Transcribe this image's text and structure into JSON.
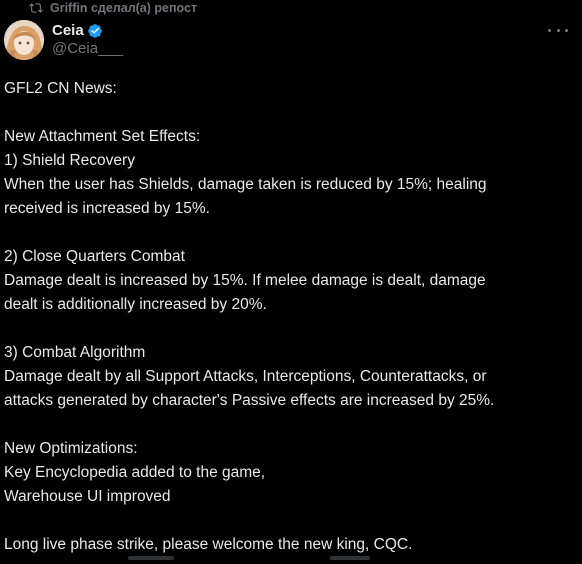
{
  "repost": {
    "icon": "repost-icon",
    "text": "Griffin сделал(а) репост"
  },
  "author": {
    "name": "Ceia",
    "handle": "@Ceia___",
    "verified_color": "#1d9bf0"
  },
  "tweet": {
    "lines": [
      "GFL2 CN News:",
      "",
      "New Attachment Set Effects:",
      "1) Shield Recovery",
      "When the user has Shields, damage taken is reduced by 15%; healing",
      "received is increased by 15%.",
      "",
      "2) Close Quarters Combat",
      "Damage dealt is increased by 15%. If melee damage is dealt, damage",
      "dealt is additionally increased by 20%.",
      "",
      "3) Combat Algorithm",
      "Damage dealt by all Support Attacks, Interceptions, Counterattacks, or",
      "attacks generated by character's Passive effects are increased by 25%.",
      "",
      "New Optimizations:",
      "Key Encyclopedia added to the game,",
      "Warehouse UI improved",
      "",
      "Long live phase strike, please welcome the new king, CQC."
    ]
  },
  "colors": {
    "background": "#000000",
    "text": "#e7e9ea",
    "secondary": "#71767b",
    "accent": "#1d9bf0"
  }
}
